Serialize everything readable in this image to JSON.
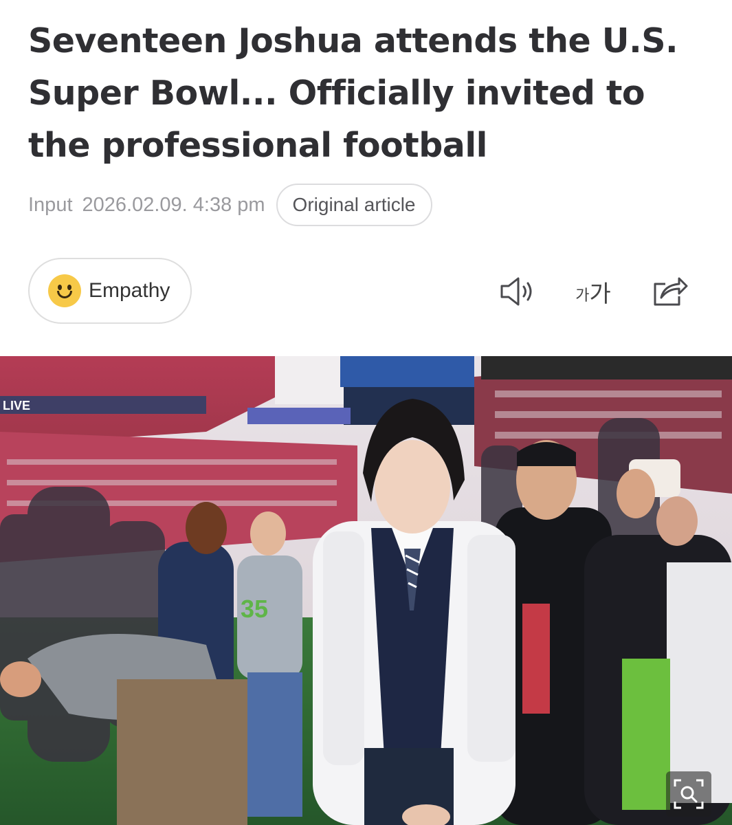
{
  "article": {
    "headline": "Seventeen Joshua attends the U.S. Super Bowl... Officially invited to the professional football",
    "input_label": "Input",
    "timestamp": "2026.02.09. 4:38 pm",
    "original_article_label": "Original article"
  },
  "toolbar": {
    "empathy_label": "Empathy",
    "font_small": "가",
    "font_big": "가",
    "icons": [
      "smiley-icon",
      "speaker-icon",
      "font-size-icon",
      "share-icon",
      "zoom-icon"
    ]
  },
  "photo": {
    "jersey_number": "35",
    "stadium_sign": "LIVE"
  },
  "colors": {
    "headline": "#2f2f33",
    "meta": "#9a9a9e",
    "smiley": "#f7c948",
    "stands": "#b43c55",
    "field": "#2f6b2f"
  }
}
